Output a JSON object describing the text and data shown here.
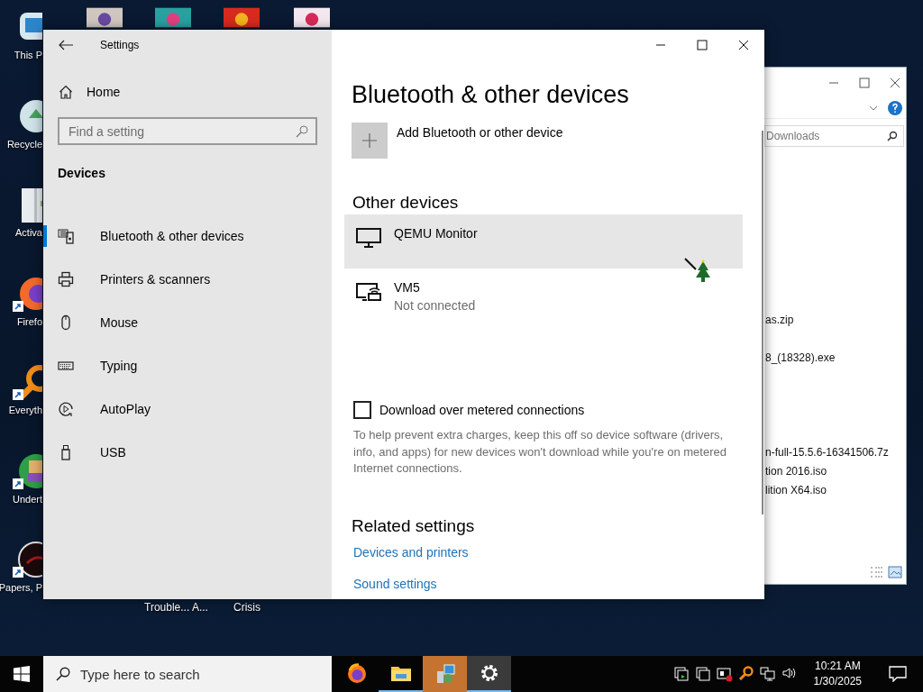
{
  "desktop_icons": [
    {
      "label": "This P",
      "kind": "computer",
      "shortcut": false
    },
    {
      "label": "Recycle",
      "kind": "recycle",
      "shortcut": false
    },
    {
      "label": "Activa",
      "kind": "book",
      "shortcut": false
    },
    {
      "label": "Firefo",
      "kind": "firefox",
      "shortcut": true
    },
    {
      "label": "Everyth",
      "kind": "search",
      "shortcut": true
    },
    {
      "label": "Undert",
      "kind": "game",
      "shortcut": true
    },
    {
      "label": "Papers, P",
      "kind": "disc",
      "shortcut": true
    }
  ],
  "desktop_bottom_labels": [
    "Trouble... A...",
    "Crisis"
  ],
  "explorer": {
    "search_placeholder": "Downloads",
    "files": [
      "as.zip",
      "8_(18328).exe",
      "n-full-15.5.6-16341506.7z",
      "tion 2016.iso",
      "lition X64.iso"
    ]
  },
  "settings": {
    "title": "Settings",
    "home": "Home",
    "search_placeholder": "Find a setting",
    "section": "Devices",
    "nav": [
      {
        "label": "Bluetooth & other devices",
        "kind": "bluetooth",
        "selected": true
      },
      {
        "label": "Printers & scanners",
        "kind": "printer",
        "selected": false
      },
      {
        "label": "Mouse",
        "kind": "mouse",
        "selected": false
      },
      {
        "label": "Typing",
        "kind": "keyboard",
        "selected": false
      },
      {
        "label": "AutoPlay",
        "kind": "autoplay",
        "selected": false
      },
      {
        "label": "USB",
        "kind": "usb",
        "selected": false
      }
    ],
    "heading": "Bluetooth & other devices",
    "add_device": "Add Bluetooth or other device",
    "other_devices_heading": "Other devices",
    "devices": [
      {
        "name": "QEMU Monitor",
        "kind": "monitor",
        "selected": true
      },
      {
        "name": "VM5",
        "status": "Not connected",
        "kind": "wireless",
        "selected": false
      }
    ],
    "metered": {
      "label": "Download over metered connections",
      "checked": false,
      "description": "To help prevent extra charges, keep this off so device software (drivers, info, and apps) for new devices won't download while you're on metered Internet connections."
    },
    "related_heading": "Related settings",
    "related_links": [
      "Devices and printers",
      "Sound settings"
    ]
  },
  "taskbar": {
    "search_placeholder": "Type here to search",
    "apps": [
      {
        "kind": "firefox",
        "running": false,
        "attention": false,
        "focused": false
      },
      {
        "kind": "folder",
        "running": true,
        "attention": false,
        "focused": false
      },
      {
        "kind": "installer",
        "running": false,
        "attention": true,
        "focused": false
      },
      {
        "kind": "gear",
        "running": true,
        "attention": false,
        "focused": true
      }
    ],
    "time": "10:21 AM",
    "date": "1/30/2025"
  }
}
